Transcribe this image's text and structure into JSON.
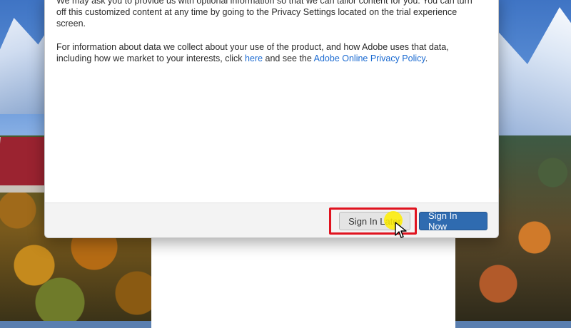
{
  "dialog": {
    "paragraph1": "We may ask you to provide us with optional information so that we can tailor content for you. You can turn off this customized content at any time by going to the Privacy Settings located on the trial experience screen.",
    "paragraph2": {
      "before_link1": "For information about data we collect about your use of the product, and how Adobe uses that data, including how we market to your interests, click ",
      "link1": "here",
      "between": " and see the ",
      "link2": "Adobe Online Privacy Policy",
      "after": "."
    },
    "buttons": {
      "sign_in_later": "Sign In Later",
      "sign_in_now": "Sign In Now"
    }
  },
  "colors": {
    "link": "#1a6ad1",
    "primary_button": "#2f6bb0",
    "highlight": "#e0131f",
    "cursor_glow": "#ffee00"
  },
  "icons": [
    "mouse-pointer-icon"
  ]
}
